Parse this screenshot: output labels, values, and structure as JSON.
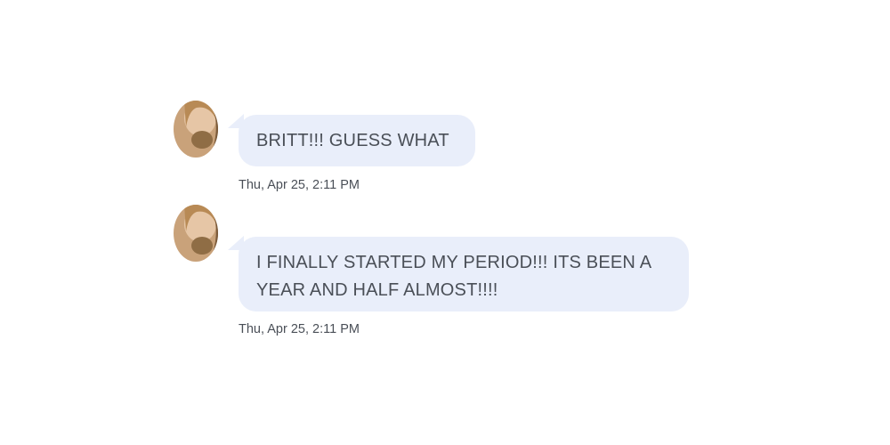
{
  "messages": [
    {
      "text": "BRITT!!! GUESS WHAT",
      "timestamp": "Thu, Apr 25, 2:11 PM",
      "avatar_icon": "contact-avatar-photo"
    },
    {
      "text": "I FINALLY STARTED MY PERIOD!!! ITS BEEN A YEAR AND HALF ALMOST!!!!",
      "timestamp": "Thu, Apr 25, 2:11 PM",
      "avatar_icon": "contact-avatar-photo"
    }
  ],
  "colors": {
    "bubble": "#e9eefa",
    "text": "#4a4f57",
    "background": "#ffffff"
  }
}
